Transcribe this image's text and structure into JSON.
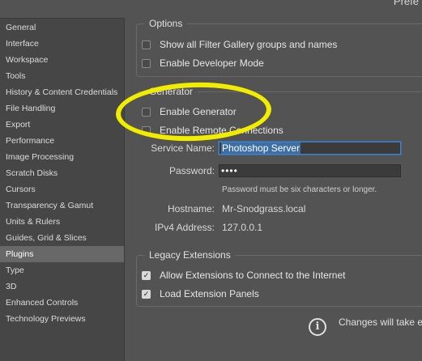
{
  "window": {
    "title_fragment": "Prefe"
  },
  "sidebar": {
    "items": [
      {
        "label": "General",
        "active": false
      },
      {
        "label": "Interface",
        "active": false
      },
      {
        "label": "Workspace",
        "active": false
      },
      {
        "label": "Tools",
        "active": false
      },
      {
        "label": "History & Content Credentials",
        "active": false
      },
      {
        "label": "File Handling",
        "active": false
      },
      {
        "label": "Export",
        "active": false
      },
      {
        "label": "Performance",
        "active": false
      },
      {
        "label": "Image Processing",
        "active": false
      },
      {
        "label": "Scratch Disks",
        "active": false
      },
      {
        "label": "Cursors",
        "active": false
      },
      {
        "label": "Transparency & Gamut",
        "active": false
      },
      {
        "label": "Units & Rulers",
        "active": false
      },
      {
        "label": "Guides, Grid & Slices",
        "active": false
      },
      {
        "label": "Plugins",
        "active": true
      },
      {
        "label": "Type",
        "active": false
      },
      {
        "label": "3D",
        "active": false
      },
      {
        "label": "Enhanced Controls",
        "active": false
      },
      {
        "label": "Technology Previews",
        "active": false
      }
    ]
  },
  "options": {
    "title": "Options",
    "show_filter_gallery": {
      "label": "Show all Filter Gallery groups and names",
      "checked": false
    },
    "enable_developer_mode": {
      "label": "Enable Developer Mode",
      "checked": false
    }
  },
  "generator": {
    "title": "Generator",
    "enable_generator": {
      "label": "Enable Generator",
      "checked": false
    },
    "enable_remote_connections": {
      "label": "Enable Remote Connections",
      "checked": false
    },
    "service_name_label": "Service Name:",
    "service_name_value": "Photoshop Server",
    "password_label": "Password:",
    "password_value": "••••",
    "password_hint": "Password must be six characters or longer.",
    "hostname_label": "Hostname:",
    "hostname_value": "Mr-Snodgrass.local",
    "ipv4_label": "IPv4 Address:",
    "ipv4_value": "127.0.0.1"
  },
  "legacy": {
    "title": "Legacy Extensions",
    "allow_extensions": {
      "label": "Allow Extensions to Connect to the Internet",
      "checked": true
    },
    "load_panels": {
      "label": "Load Extension Panels",
      "checked": true
    }
  },
  "footer": {
    "info_icon": "info-icon",
    "message": "Changes will take e"
  },
  "colors": {
    "background": "#535353",
    "sidebar_bg": "#464646",
    "sidebar_active": "#686868",
    "highlight_annotation": "#f2ec00",
    "selection": "#3d6fa6"
  }
}
